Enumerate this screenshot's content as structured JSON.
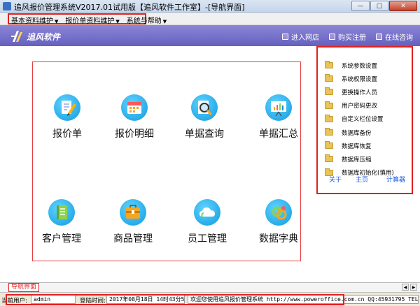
{
  "window": {
    "title": "追风报价管理系统V2017.01试用版【追风软件工作室】-[导航界面]",
    "buttons": {
      "minimize": "—",
      "maximize": "□",
      "close": "✕"
    }
  },
  "menubar": {
    "items": [
      {
        "label": "基本资料维护"
      },
      {
        "label": "报价单资料维护"
      },
      {
        "label": "系统与帮助"
      }
    ]
  },
  "header": {
    "logo_text": "追风软件",
    "links": [
      {
        "label": "进入网店"
      },
      {
        "label": "购买注册"
      },
      {
        "label": "在线咨询"
      }
    ]
  },
  "tiles": [
    {
      "label": "报价单",
      "icon": "pencil-document-icon"
    },
    {
      "label": "报价明细",
      "icon": "calendar-icon"
    },
    {
      "label": "单据查询",
      "icon": "magnifier-icon"
    },
    {
      "label": "单据汇总",
      "icon": "presentation-chart-icon"
    },
    {
      "label": "客户管理",
      "icon": "address-book-icon"
    },
    {
      "label": "商品管理",
      "icon": "briefcase-icon"
    },
    {
      "label": "员工管理",
      "icon": "cloud-icon"
    },
    {
      "label": "数据字典",
      "icon": "rings-icon"
    }
  ],
  "side_panel": {
    "items": [
      {
        "label": "系统参数设置"
      },
      {
        "label": "系统权限设置"
      },
      {
        "label": "更换操作人员"
      },
      {
        "label": "用户密码更改"
      },
      {
        "label": "自定义栏位设置"
      },
      {
        "label": "数据库备份"
      },
      {
        "label": "数据库恢复"
      },
      {
        "label": "数据库压缩"
      },
      {
        "label": "数据库初始化(慎用)"
      }
    ],
    "links": {
      "about": "关于",
      "home": "主页",
      "calculator": "计算器"
    }
  },
  "tab": {
    "label": "导航界面"
  },
  "status": {
    "user_label": "当前用户:",
    "user_value": "admin",
    "login_label": "登陆时间:",
    "login_value": "2017年08月18日 14时43分57秒",
    "welcome": "欢迎您使用追风报价管理系统 http://www.poweroffice.com.cn QQ:45931795 TEL:15"
  }
}
